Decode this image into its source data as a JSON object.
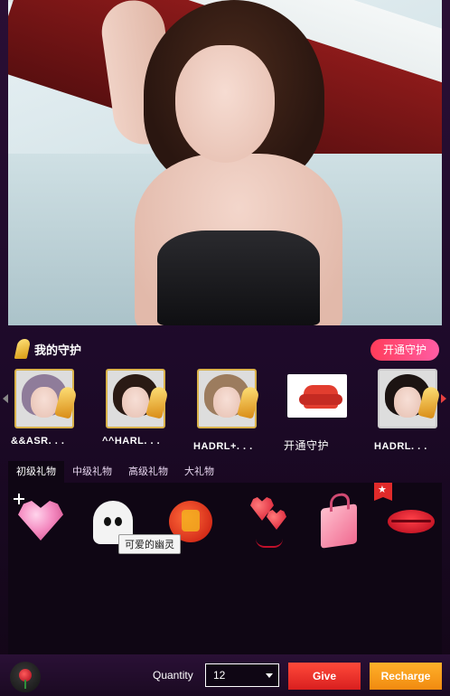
{
  "guard_section": {
    "title": "我的守护",
    "open_button": "开通守护",
    "guards": [
      {
        "name": "&&ASR. . .",
        "hair": "#8f7c9a"
      },
      {
        "name": "^^HARL. . .",
        "hair": "#2a1a14"
      },
      {
        "name": "HADRL+. . .",
        "hair": "#9c7c5e"
      },
      {
        "name": "开通守护",
        "is_open_slot": true,
        "icon": "sofa-icon"
      },
      {
        "name": "HADRL. . .",
        "hair": "#1c1412"
      }
    ]
  },
  "gift_tabs": [
    {
      "label": "初级礼物",
      "active": true
    },
    {
      "label": "中级礼物",
      "active": false
    },
    {
      "label": "高级礼物",
      "active": false
    },
    {
      "label": "大礼物",
      "active": false
    }
  ],
  "gifts": [
    {
      "icon": "pink-diamond-heart-icon"
    },
    {
      "icon": "ghost-icon",
      "tooltip": "可爱的幽灵"
    },
    {
      "icon": "lantern-icon"
    },
    {
      "icon": "heart-balloons-icon"
    },
    {
      "icon": "handbag-icon"
    },
    {
      "icon": "lips-icon",
      "badge": "star"
    }
  ],
  "bottom_bar": {
    "quantity_label": "Quantity",
    "quantity_value": "12",
    "give_label": "Give",
    "recharge_label": "Recharge"
  },
  "colors": {
    "accent_pink": "#ff3c5a",
    "give_red": "#d91f1f",
    "recharge_orange": "#f18a10",
    "frame_gold": "#d9b24a"
  }
}
